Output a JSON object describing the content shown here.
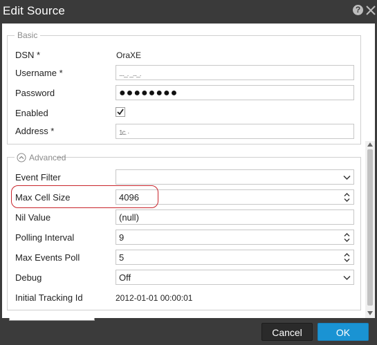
{
  "dialog": {
    "title": "Edit Source",
    "help_icon": "?"
  },
  "basic": {
    "legend": "Basic",
    "dsn_label": "DSN *",
    "dsn_value": "OraXE",
    "username_label": "Username *",
    "username_value": "...._. _..._.",
    "password_label": "Password",
    "password_value": "●●●●●●●●",
    "enabled_label": "Enabled",
    "enabled_checked": true,
    "address_label": "Address *",
    "address_value": "1c. ·"
  },
  "advanced": {
    "legend": "Advanced",
    "event_filter_label": "Event Filter",
    "event_filter_value": "",
    "max_cell_size_label": "Max Cell Size",
    "max_cell_size_value": "4096",
    "nil_value_label": "Nil Value",
    "nil_value_value": "(null)",
    "polling_interval_label": "Polling Interval",
    "polling_interval_value": "9",
    "max_events_poll_label": "Max Events Poll",
    "max_events_poll_value": "5",
    "debug_label": "Debug",
    "debug_value": "Off",
    "initial_tracking_id_label": "Initial Tracking Id",
    "initial_tracking_id_value": "2012-01-01 00:00:01"
  },
  "footer": {
    "cancel_label": "Cancel",
    "ok_label": "OK"
  },
  "colors": {
    "titlebar": "#3a3a3a",
    "ok_button": "#1a93d3",
    "highlight": "#c8232a"
  }
}
